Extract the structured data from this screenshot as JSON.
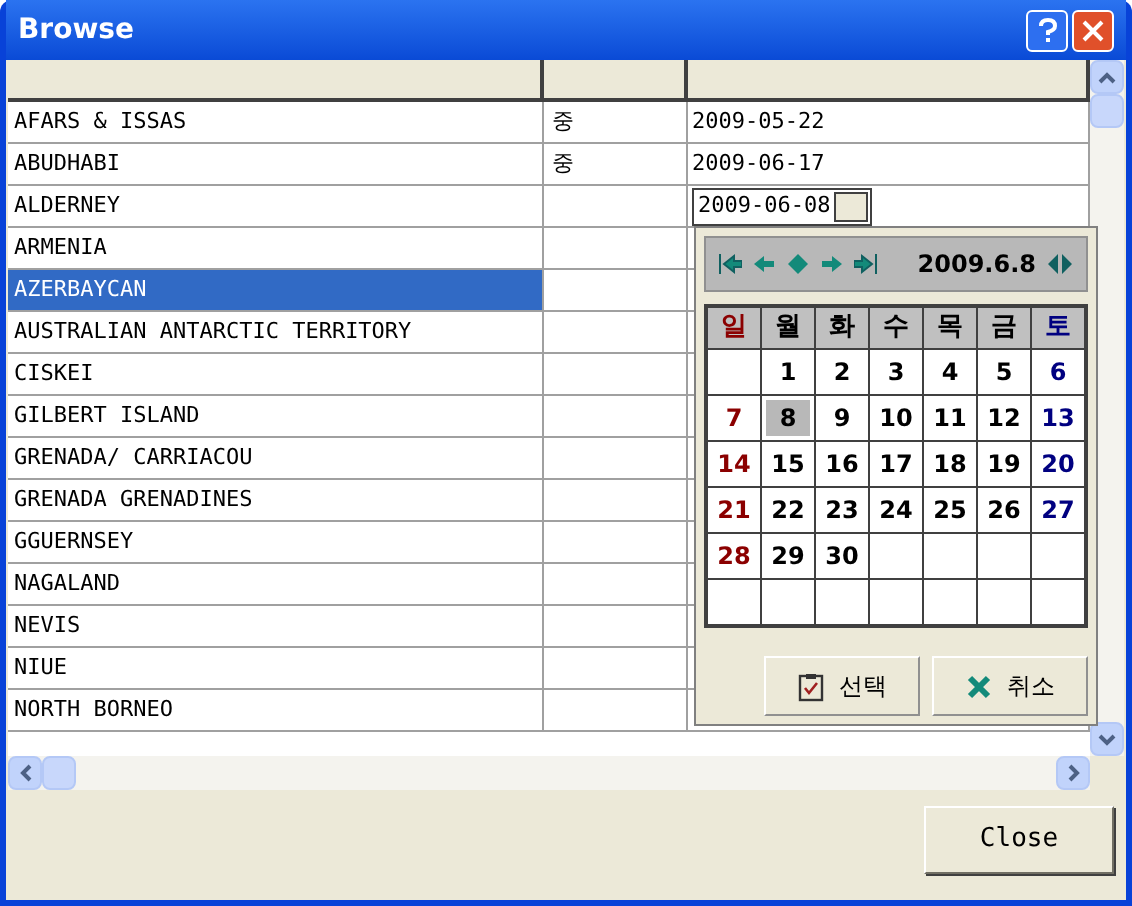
{
  "window": {
    "title": "Browse"
  },
  "rows": [
    {
      "name": "AFARS & ISSAS",
      "column_2": "중",
      "column_3": "2009-05-22",
      "selected": false
    },
    {
      "name": "ABUDHABI",
      "column_2": "중",
      "column_3": "2009-06-17",
      "selected": false
    },
    {
      "name": "ALDERNEY",
      "selected": false,
      "editor": {
        "value": "2009-06-08"
      }
    },
    {
      "name": "ARMENIA",
      "selected": false
    },
    {
      "name": "AZERBAYCAN",
      "selected": true
    },
    {
      "name": "AUSTRALIAN ANTARCTIC TERRITORY",
      "selected": false
    },
    {
      "name": "CISKEI",
      "selected": false
    },
    {
      "name": "GILBERT ISLAND",
      "selected": false
    },
    {
      "name": "GRENADA/ CARRIACOU",
      "selected": false
    },
    {
      "name": "GRENADA GRENADINES",
      "selected": false
    },
    {
      "name": "GGUERNSEY",
      "selected": false
    },
    {
      "name": "NAGALAND",
      "selected": false
    },
    {
      "name": "NEVIS",
      "selected": false
    },
    {
      "name": "NIUE",
      "selected": false
    },
    {
      "name": "NORTH BORNEO",
      "selected": false
    }
  ],
  "calendar": {
    "title": "2009.6.8",
    "weekdays": [
      {
        "label": "일",
        "color": "#8b0000"
      },
      {
        "label": "월",
        "color": "#000000"
      },
      {
        "label": "화",
        "color": "#000000"
      },
      {
        "label": "수",
        "color": "#000000"
      },
      {
        "label": "목",
        "color": "#000000"
      },
      {
        "label": "금",
        "color": "#000000"
      },
      {
        "label": "토",
        "color": "#000080"
      }
    ],
    "weeks": [
      [
        {
          "kind": "blank"
        },
        {
          "day": "1",
          "selected": false
        },
        {
          "day": "2",
          "selected": false
        },
        {
          "day": "3",
          "selected": false
        },
        {
          "day": "4",
          "selected": false
        },
        {
          "day": "5",
          "selected": false
        },
        {
          "day": "6",
          "selected": false
        }
      ],
      [
        {
          "day": "7",
          "selected": false
        },
        {
          "day": "8",
          "selected": true
        },
        {
          "day": "9",
          "selected": false
        },
        {
          "day": "10",
          "selected": false
        },
        {
          "day": "11",
          "selected": false
        },
        {
          "day": "12",
          "selected": false
        },
        {
          "day": "13",
          "selected": false
        }
      ],
      [
        {
          "day": "14",
          "selected": false
        },
        {
          "day": "15",
          "selected": false
        },
        {
          "day": "16",
          "selected": false
        },
        {
          "day": "17",
          "selected": false
        },
        {
          "day": "18",
          "selected": false
        },
        {
          "day": "19",
          "selected": false
        },
        {
          "day": "20",
          "selected": false
        }
      ],
      [
        {
          "day": "21",
          "selected": false
        },
        {
          "day": "22",
          "selected": false
        },
        {
          "day": "23",
          "selected": false
        },
        {
          "day": "24",
          "selected": false
        },
        {
          "day": "25",
          "selected": false
        },
        {
          "day": "26",
          "selected": false
        },
        {
          "day": "27",
          "selected": false
        }
      ],
      [
        {
          "day": "28",
          "selected": false
        },
        {
          "day": "29",
          "selected": false
        },
        {
          "day": "30",
          "selected": false
        },
        {
          "kind": "blank"
        },
        {
          "kind": "blank"
        },
        {
          "kind": "blank"
        },
        {
          "kind": "blank"
        }
      ],
      [
        {
          "kind": "blank"
        },
        {
          "kind": "blank"
        },
        {
          "kind": "blank"
        },
        {
          "kind": "blank"
        },
        {
          "kind": "blank"
        },
        {
          "kind": "blank"
        },
        {
          "kind": "blank"
        }
      ]
    ],
    "buttons": [
      {
        "label": "선택",
        "kind": "ok"
      },
      {
        "label": "취소",
        "kind": "cancel"
      }
    ]
  },
  "buttons": [
    "Close"
  ]
}
